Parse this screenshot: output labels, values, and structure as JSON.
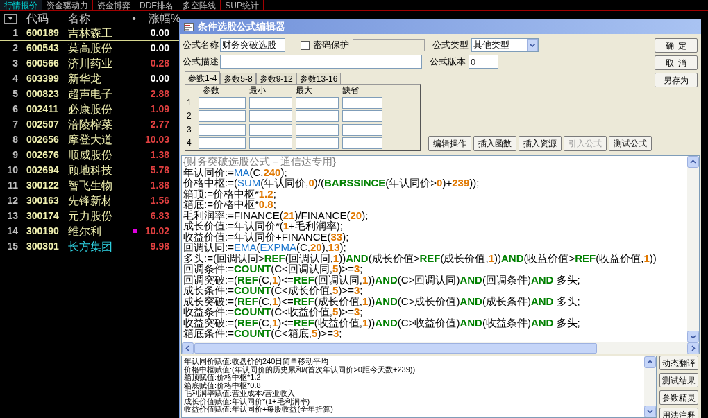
{
  "market_tabs": [
    {
      "label": "行情报价",
      "selected": true
    },
    {
      "label": "资金驱动力",
      "selected": false
    },
    {
      "label": "资金博弈",
      "selected": false
    },
    {
      "label": "DDE排名",
      "selected": false
    },
    {
      "label": "多空阵线",
      "selected": false
    },
    {
      "label": "SUP统计",
      "selected": false
    }
  ],
  "quote_table": {
    "columns": [
      "代码",
      "名称",
      "•",
      "涨幅%"
    ],
    "rows": [
      {
        "index": "1",
        "code": "600189",
        "name": "吉林森工",
        "change": "0.00",
        "up": false,
        "selected": true,
        "highlighted": false,
        "marked": false
      },
      {
        "index": "2",
        "code": "600543",
        "name": "莫高股份",
        "change": "0.00",
        "up": false,
        "selected": false,
        "highlighted": false,
        "marked": false
      },
      {
        "index": "3",
        "code": "600566",
        "name": "济川药业",
        "change": "0.28",
        "up": true,
        "selected": false,
        "highlighted": false,
        "marked": false
      },
      {
        "index": "4",
        "code": "603399",
        "name": "新华龙",
        "change": "0.00",
        "up": false,
        "selected": false,
        "highlighted": false,
        "marked": false
      },
      {
        "index": "5",
        "code": "000823",
        "name": "超声电子",
        "change": "2.88",
        "up": true,
        "selected": false,
        "highlighted": false,
        "marked": false
      },
      {
        "index": "6",
        "code": "002411",
        "name": "必康股份",
        "change": "1.09",
        "up": true,
        "selected": false,
        "highlighted": false,
        "marked": false
      },
      {
        "index": "7",
        "code": "002507",
        "name": "涪陵榨菜",
        "change": "2.77",
        "up": true,
        "selected": false,
        "highlighted": false,
        "marked": false
      },
      {
        "index": "8",
        "code": "002656",
        "name": "摩登大道",
        "change": "10.03",
        "up": true,
        "selected": false,
        "highlighted": false,
        "marked": false
      },
      {
        "index": "9",
        "code": "002676",
        "name": "顺威股份",
        "change": "1.38",
        "up": true,
        "selected": false,
        "highlighted": false,
        "marked": false
      },
      {
        "index": "10",
        "code": "002694",
        "name": "顾地科技",
        "change": "5.78",
        "up": true,
        "selected": false,
        "highlighted": false,
        "marked": false
      },
      {
        "index": "11",
        "code": "300122",
        "name": "智飞生物",
        "change": "1.88",
        "up": true,
        "selected": false,
        "highlighted": false,
        "marked": false
      },
      {
        "index": "12",
        "code": "300163",
        "name": "先锋新材",
        "change": "1.56",
        "up": true,
        "selected": false,
        "highlighted": false,
        "marked": false
      },
      {
        "index": "13",
        "code": "300174",
        "name": "元力股份",
        "change": "6.83",
        "up": true,
        "selected": false,
        "highlighted": false,
        "marked": false
      },
      {
        "index": "14",
        "code": "300190",
        "name": "维尔利",
        "change": "10.02",
        "up": true,
        "selected": false,
        "highlighted": false,
        "marked": true
      },
      {
        "index": "15",
        "code": "300301",
        "name": "长方集团",
        "change": "9.98",
        "up": true,
        "selected": false,
        "highlighted": true,
        "marked": false
      }
    ]
  },
  "dialog": {
    "title": "条件选股公式编辑器",
    "name_label": "公式名称",
    "name_value": "财务突破选股",
    "password": {
      "label": "密码保护",
      "checked": false
    },
    "type_label": "公式类型",
    "type_value": "其他类型",
    "desc_label": "公式描述",
    "version_label": "公式版本",
    "version_value": "0",
    "side_buttons": [
      "确  定",
      "取  消",
      "另存为"
    ],
    "param_tabs": [
      {
        "label": "参数1-4",
        "selected": true
      },
      {
        "label": "参数5-8",
        "selected": false
      },
      {
        "label": "参数9-12",
        "selected": false
      },
      {
        "label": "参数13-16",
        "selected": false
      }
    ],
    "param_columns": [
      "参数",
      "最小",
      "最大",
      "缺省"
    ],
    "param_rows": [
      "1",
      "2",
      "3",
      "4"
    ],
    "tool_buttons": [
      {
        "label": "编辑操作",
        "disabled": false
      },
      {
        "label": "插入函数",
        "disabled": false
      },
      {
        "label": "插入资源",
        "disabled": false
      },
      {
        "label": "引入公式",
        "disabled": true
      },
      {
        "label": "测试公式",
        "disabled": false
      }
    ],
    "code_lines": [
      [
        {
          "kind": "comment",
          "text": "{财务突破选股公式－通信达专用}"
        }
      ],
      [
        {
          "kind": "plain",
          "text": "年认同价:="
        },
        {
          "kind": "function",
          "text": "MA"
        },
        {
          "kind": "plain",
          "text": "(C,"
        },
        {
          "kind": "number",
          "text": "240"
        },
        {
          "kind": "plain",
          "text": ");"
        }
      ],
      [
        {
          "kind": "plain",
          "text": "价格中枢:=("
        },
        {
          "kind": "function",
          "text": "SUM"
        },
        {
          "kind": "plain",
          "text": "(年认同价,"
        },
        {
          "kind": "number",
          "text": "0"
        },
        {
          "kind": "plain",
          "text": ")/("
        },
        {
          "kind": "keyword",
          "text": "BARSSINCE"
        },
        {
          "kind": "plain",
          "text": "(年认同价>"
        },
        {
          "kind": "number",
          "text": "0"
        },
        {
          "kind": "plain",
          "text": ")+"
        },
        {
          "kind": "number",
          "text": "239"
        },
        {
          "kind": "plain",
          "text": "));"
        }
      ],
      [
        {
          "kind": "plain",
          "text": "箱顶:=价格中枢*"
        },
        {
          "kind": "number",
          "text": "1.2"
        },
        {
          "kind": "plain",
          "text": ";"
        }
      ],
      [
        {
          "kind": "plain",
          "text": "箱底:=价格中枢*"
        },
        {
          "kind": "number",
          "text": "0.8"
        },
        {
          "kind": "plain",
          "text": ";"
        }
      ],
      [
        {
          "kind": "plain",
          "text": "毛利润率:=FINANCE("
        },
        {
          "kind": "number",
          "text": "21"
        },
        {
          "kind": "plain",
          "text": ")/FINANCE("
        },
        {
          "kind": "number",
          "text": "20"
        },
        {
          "kind": "plain",
          "text": ");"
        }
      ],
      [
        {
          "kind": "plain",
          "text": "成长价值:=年认同价*("
        },
        {
          "kind": "number",
          "text": "1"
        },
        {
          "kind": "plain",
          "text": "+毛利润率);"
        }
      ],
      [
        {
          "kind": "plain",
          "text": "收益价值:=年认同价+FINANCE("
        },
        {
          "kind": "number",
          "text": "33"
        },
        {
          "kind": "plain",
          "text": ");"
        }
      ],
      [
        {
          "kind": "plain",
          "text": "回调认同:="
        },
        {
          "kind": "function",
          "text": "EMA"
        },
        {
          "kind": "plain",
          "text": "("
        },
        {
          "kind": "function",
          "text": "EXPMA"
        },
        {
          "kind": "plain",
          "text": "(C,"
        },
        {
          "kind": "number",
          "text": "20"
        },
        {
          "kind": "plain",
          "text": "),"
        },
        {
          "kind": "number",
          "text": "13"
        },
        {
          "kind": "plain",
          "text": ");"
        }
      ],
      [
        {
          "kind": "plain",
          "text": "多头:=(回调认同>"
        },
        {
          "kind": "keyword",
          "text": "REF"
        },
        {
          "kind": "plain",
          "text": "(回调认同,"
        },
        {
          "kind": "number",
          "text": "1"
        },
        {
          "kind": "plain",
          "text": "))"
        },
        {
          "kind": "keyword",
          "text": "AND"
        },
        {
          "kind": "plain",
          "text": "(成长价值>"
        },
        {
          "kind": "keyword",
          "text": "REF"
        },
        {
          "kind": "plain",
          "text": "(成长价值,"
        },
        {
          "kind": "number",
          "text": "1"
        },
        {
          "kind": "plain",
          "text": "))"
        },
        {
          "kind": "keyword",
          "text": "AND"
        },
        {
          "kind": "plain",
          "text": "(收益价值>"
        },
        {
          "kind": "keyword",
          "text": "REF"
        },
        {
          "kind": "plain",
          "text": "(收益价值,"
        },
        {
          "kind": "number",
          "text": "1"
        },
        {
          "kind": "plain",
          "text": "))"
        }
      ],
      [
        {
          "kind": "plain",
          "text": "回调条件:="
        },
        {
          "kind": "keyword",
          "text": "COUNT"
        },
        {
          "kind": "plain",
          "text": "(C<回调认同,"
        },
        {
          "kind": "number",
          "text": "5"
        },
        {
          "kind": "plain",
          "text": ")>="
        },
        {
          "kind": "number",
          "text": "3"
        },
        {
          "kind": "plain",
          "text": ";"
        }
      ],
      [
        {
          "kind": "plain",
          "text": "回调突破:=("
        },
        {
          "kind": "keyword",
          "text": "REF"
        },
        {
          "kind": "plain",
          "text": "(C,"
        },
        {
          "kind": "number",
          "text": "1"
        },
        {
          "kind": "plain",
          "text": ")<="
        },
        {
          "kind": "keyword",
          "text": "REF"
        },
        {
          "kind": "plain",
          "text": "(回调认同,"
        },
        {
          "kind": "number",
          "text": "1"
        },
        {
          "kind": "plain",
          "text": "))"
        },
        {
          "kind": "keyword",
          "text": "AND"
        },
        {
          "kind": "plain",
          "text": "(C>回调认同)"
        },
        {
          "kind": "keyword",
          "text": "AND"
        },
        {
          "kind": "plain",
          "text": "(回调条件)"
        },
        {
          "kind": "keyword",
          "text": "AND"
        },
        {
          "kind": "plain",
          "text": " 多头;"
        }
      ],
      [
        {
          "kind": "plain",
          "text": "成长条件:="
        },
        {
          "kind": "keyword",
          "text": "COUNT"
        },
        {
          "kind": "plain",
          "text": "(C<成长价值,"
        },
        {
          "kind": "number",
          "text": "5"
        },
        {
          "kind": "plain",
          "text": ")>="
        },
        {
          "kind": "number",
          "text": "3"
        },
        {
          "kind": "plain",
          "text": ";"
        }
      ],
      [
        {
          "kind": "plain",
          "text": "成长突破:=("
        },
        {
          "kind": "keyword",
          "text": "REF"
        },
        {
          "kind": "plain",
          "text": "(C,"
        },
        {
          "kind": "number",
          "text": "1"
        },
        {
          "kind": "plain",
          "text": ")<="
        },
        {
          "kind": "keyword",
          "text": "REF"
        },
        {
          "kind": "plain",
          "text": "(成长价值,"
        },
        {
          "kind": "number",
          "text": "1"
        },
        {
          "kind": "plain",
          "text": "))"
        },
        {
          "kind": "keyword",
          "text": "AND"
        },
        {
          "kind": "plain",
          "text": "(C>成长价值)"
        },
        {
          "kind": "keyword",
          "text": "AND"
        },
        {
          "kind": "plain",
          "text": "(成长条件)"
        },
        {
          "kind": "keyword",
          "text": "AND"
        },
        {
          "kind": "plain",
          "text": " 多头;"
        }
      ],
      [
        {
          "kind": "plain",
          "text": "收益条件:="
        },
        {
          "kind": "keyword",
          "text": "COUNT"
        },
        {
          "kind": "plain",
          "text": "(C<收益价值,"
        },
        {
          "kind": "number",
          "text": "5"
        },
        {
          "kind": "plain",
          "text": ")>="
        },
        {
          "kind": "number",
          "text": "3"
        },
        {
          "kind": "plain",
          "text": ";"
        }
      ],
      [
        {
          "kind": "plain",
          "text": "收益突破:=("
        },
        {
          "kind": "keyword",
          "text": "REF"
        },
        {
          "kind": "plain",
          "text": "(C,"
        },
        {
          "kind": "number",
          "text": "1"
        },
        {
          "kind": "plain",
          "text": ")<="
        },
        {
          "kind": "keyword",
          "text": "REF"
        },
        {
          "kind": "plain",
          "text": "(收益价值,"
        },
        {
          "kind": "number",
          "text": "1"
        },
        {
          "kind": "plain",
          "text": "))"
        },
        {
          "kind": "keyword",
          "text": "AND"
        },
        {
          "kind": "plain",
          "text": "(C>收益价值)"
        },
        {
          "kind": "keyword",
          "text": "AND"
        },
        {
          "kind": "plain",
          "text": "(收益条件)"
        },
        {
          "kind": "keyword",
          "text": "AND"
        },
        {
          "kind": "plain",
          "text": " 多头;"
        }
      ],
      [
        {
          "kind": "plain",
          "text": "箱底条件:="
        },
        {
          "kind": "keyword",
          "text": "COUNT"
        },
        {
          "kind": "plain",
          "text": "(C<箱底,"
        },
        {
          "kind": "number",
          "text": "5"
        },
        {
          "kind": "plain",
          "text": ")>="
        },
        {
          "kind": "number",
          "text": "3"
        },
        {
          "kind": "plain",
          "text": ";"
        }
      ]
    ],
    "description_lines": [
      "年认同价赋值:收盘价的240日简单移动平均",
      "价格中枢赋值:(年认同价的历史累和/(首次年认同价>0距今天数+239))",
      "箱顶赋值:价格中枢*1.2",
      "箱底赋值:价格中枢*0.8",
      "毛利润率赋值:营业成本/营业收入",
      "成长价值赋值:年认同价*(1+毛利润率)",
      "收益价值赋值:年认同价+每股收益(全年折算)"
    ],
    "help_buttons": [
      "动态翻译",
      "测试结果",
      "参数精灵",
      "用法注释"
    ]
  }
}
